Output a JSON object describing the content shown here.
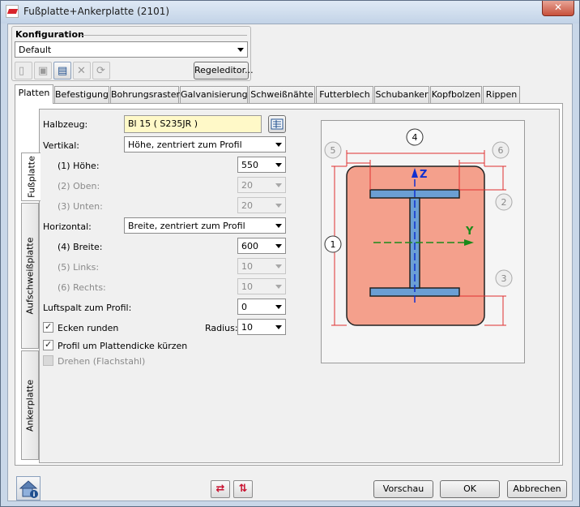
{
  "window": {
    "title": "Fußplatte+Ankerplatte (2101)",
    "close_label": "✕"
  },
  "config": {
    "group_label": "Konfiguration",
    "selected": "Default",
    "toolbar": [
      {
        "icon": "new-document-icon",
        "glyph": "▯",
        "enabled": false
      },
      {
        "icon": "save-icon",
        "glyph": "▣",
        "enabled": false
      },
      {
        "icon": "save-as-icon",
        "glyph": "▤",
        "enabled": true
      },
      {
        "icon": "delete-icon",
        "glyph": "✕",
        "enabled": false
      },
      {
        "icon": "refresh-icon",
        "glyph": "⟳",
        "enabled": false
      }
    ],
    "rule_editor_label": "Regeleditor..."
  },
  "tabs": [
    "Platten",
    "Befestigung",
    "Bohrungsraster",
    "Galvanisierung",
    "Schweißnähte",
    "Futterblech",
    "Schubanker",
    "Kopfbolzen",
    "Rippen"
  ],
  "side_tabs": [
    "Fußplatte",
    "Aufschweißplatte",
    "Ankerplatte"
  ],
  "form": {
    "halbzeug_label": "Halbzeug:",
    "halbzeug_value": "Bl 15  ( S235JR )",
    "vertikal_label": "Vertikal:",
    "vertikal_value": "Höhe, zentriert zum Profil",
    "hoehe_label": "(1) Höhe:",
    "hoehe_value": "550",
    "oben_label": "(2) Oben:",
    "oben_value": "20",
    "unten_label": "(3) Unten:",
    "unten_value": "20",
    "horizontal_label": "Horizontal:",
    "horizontal_value": "Breite, zentriert zum Profil",
    "breite_label": "(4) Breite:",
    "breite_value": "600",
    "links_label": "(5) Links:",
    "links_value": "10",
    "rechts_label": "(6) Rechts:",
    "rechts_value": "10",
    "luftspalt_label": "Luftspalt zum Profil:",
    "luftspalt_value": "0",
    "ecken_label": "Ecken runden",
    "radius_label": "Radius:",
    "radius_value": "10",
    "profil_label": "Profil um Plattendicke kürzen",
    "drehen_label": "Drehen (Flachstahl)"
  },
  "preview": {
    "plate_color": "#f4a08c",
    "profile_color": "#6b9fd4",
    "z_label": "Z",
    "y_label": "Y",
    "dims": [
      "1",
      "2",
      "3",
      "4",
      "5",
      "6"
    ]
  },
  "footer": {
    "vorschau": "Vorschau",
    "ok": "OK",
    "abbrechen": "Abbrechen"
  }
}
